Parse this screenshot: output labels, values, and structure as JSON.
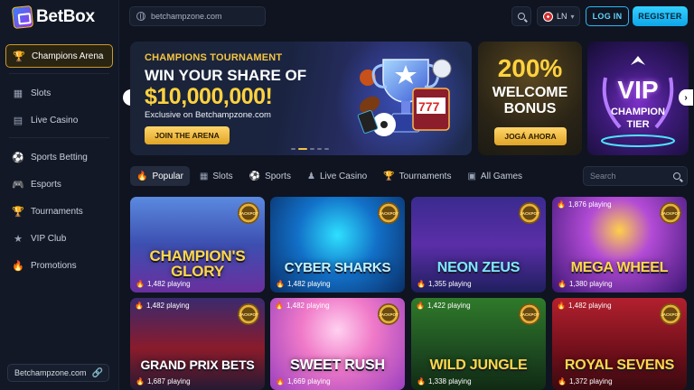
{
  "brand": {
    "name": "BetBox"
  },
  "sidebar": {
    "items": [
      {
        "label": "Champions Arena",
        "icon": "trophy-icon",
        "active": true
      },
      {
        "label": "Slots",
        "icon": "slots-icon"
      },
      {
        "label": "Live Casino",
        "icon": "cards-icon"
      },
      {
        "label": "Sports Betting",
        "icon": "soccer-ball-icon"
      },
      {
        "label": "Esports",
        "icon": "gamepad-icon"
      },
      {
        "label": "Tournaments",
        "icon": "trophy-icon"
      },
      {
        "label": "VIP Club",
        "icon": "star-icon"
      },
      {
        "label": "Promotions",
        "icon": "fire-icon"
      }
    ],
    "site": "Betchampzone.com"
  },
  "header": {
    "url": "betchampzone.com",
    "lang": "LN",
    "login": "LOG IN",
    "register": "REGISTER"
  },
  "banners": {
    "main": {
      "kicker": "CHAMPIONS TOURNAMENT",
      "headline": "WIN YOUR SHARE OF",
      "amount": "$10,000,000!",
      "sub": "Exclusive on Betchampzone.com",
      "cta": "JOIN THE ARENA"
    },
    "bonus": {
      "pct": "200%",
      "line1": "WELCOME",
      "line2": "BONUS",
      "cta": "JOGÁ AHORA"
    },
    "vip": {
      "line1": "VIP",
      "line2": "CHAMPION",
      "line3": "TIER"
    }
  },
  "tabs": [
    {
      "label": "Popular",
      "icon": "fire-icon",
      "active": true
    },
    {
      "label": "Slots",
      "icon": "slots-icon"
    },
    {
      "label": "Sports",
      "icon": "soccer-ball-icon"
    },
    {
      "label": "Live Casino",
      "icon": "dealer-icon"
    },
    {
      "label": "Tournaments",
      "icon": "trophy-icon"
    },
    {
      "label": "All Games",
      "icon": "grid-icon"
    }
  ],
  "game_search": {
    "placeholder": "Search"
  },
  "jackpot_label": "JACKPOT",
  "games": [
    {
      "title_1": "CHAMPION'S",
      "title_2": "GLORY",
      "playing": "1,482 playing"
    },
    {
      "title_1": "CYBER SHARKS",
      "playing": "1,482 playing"
    },
    {
      "title_1": "NEON ZEUS",
      "playing": "1,355 playing"
    },
    {
      "title_1": "MEGA WHEEL",
      "playing_top": "1,876 playing",
      "playing": "1,380 playing"
    },
    {
      "title_1": "GRAND PRIX BETS",
      "playing_top": "1,482 playing",
      "playing": "1,687 playing"
    },
    {
      "title_1": "SWEET RUSH",
      "playing_top": "1,482 playing",
      "playing": "1,669 playing"
    },
    {
      "title_1": "WILD JUNGLE",
      "playing_top": "1,422 playing",
      "playing": "1,338 playing"
    },
    {
      "title_1": "ROYAL SEVENS",
      "playing_top": "1,482 playing",
      "playing": "1,372 playing"
    }
  ]
}
